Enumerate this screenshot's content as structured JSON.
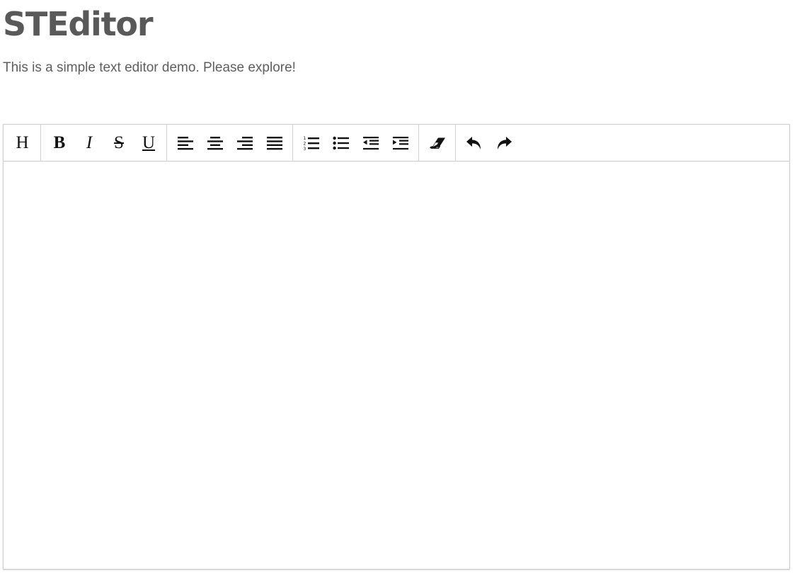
{
  "page": {
    "title": "STEditor",
    "subtitle": "This is a simple text editor demo. Please explore!"
  },
  "toolbar": {
    "groups": [
      {
        "name": "heading",
        "buttons": [
          {
            "label": "H",
            "icon": "heading-icon"
          }
        ]
      },
      {
        "name": "text-style",
        "buttons": [
          {
            "label": "B",
            "icon": "bold-icon"
          },
          {
            "label": "I",
            "icon": "italic-icon"
          },
          {
            "label": "S",
            "icon": "strikethrough-icon"
          },
          {
            "label": "U",
            "icon": "underline-icon"
          }
        ]
      },
      {
        "name": "alignment",
        "buttons": [
          {
            "icon": "align-left-icon"
          },
          {
            "icon": "align-center-icon"
          },
          {
            "icon": "align-right-icon"
          },
          {
            "icon": "align-justify-icon"
          }
        ]
      },
      {
        "name": "lists-indent",
        "buttons": [
          {
            "icon": "ordered-list-icon"
          },
          {
            "icon": "unordered-list-icon"
          },
          {
            "icon": "outdent-icon"
          },
          {
            "icon": "indent-icon"
          }
        ]
      },
      {
        "name": "clear-format",
        "buttons": [
          {
            "icon": "eraser-icon"
          }
        ]
      },
      {
        "name": "history",
        "buttons": [
          {
            "icon": "undo-icon"
          },
          {
            "icon": "redo-icon"
          }
        ]
      }
    ]
  },
  "editor": {
    "content": ""
  },
  "colors": {
    "title": "#595959",
    "text": "#5e5e5e",
    "border": "#cccccc",
    "icon": "#111111"
  }
}
